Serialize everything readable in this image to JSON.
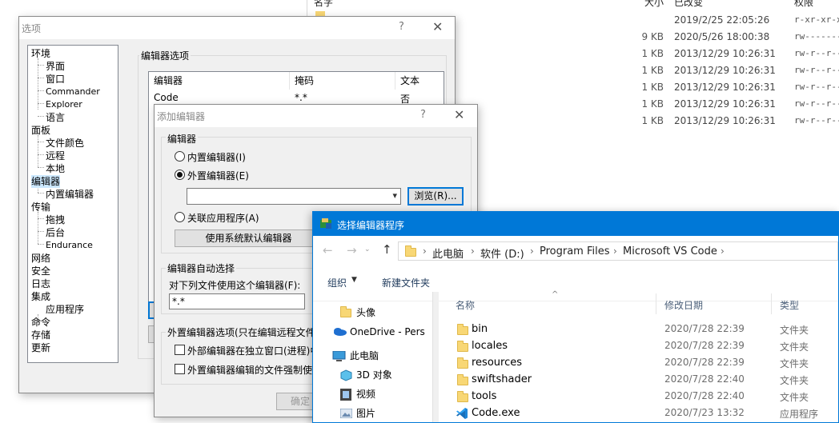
{
  "background": {
    "headers": {
      "name": "名字",
      "size": "大小",
      "modified": "已改变",
      "perms": "权限"
    },
    "rows": [
      {
        "size": "",
        "date": "2019/2/25 22:05:26",
        "perm": "r-xr-xr-x"
      },
      {
        "size": "9 KB",
        "date": "2020/5/26 18:00:38",
        "perm": "rw-------"
      },
      {
        "size": "1 KB",
        "date": "2013/12/29 10:26:31",
        "perm": "rw-r--r--"
      },
      {
        "size": "1 KB",
        "date": "2013/12/29 10:26:31",
        "perm": "rw-r--r--"
      },
      {
        "size": "1 KB",
        "date": "2013/12/29 10:26:31",
        "perm": "rw-r--r--"
      },
      {
        "size": "1 KB",
        "date": "2013/12/29 10:26:31",
        "perm": "rw-r--r--"
      },
      {
        "size": "1 KB",
        "date": "2013/12/29 10:26:31",
        "perm": "rw-r--r--"
      }
    ]
  },
  "options_dialog": {
    "title": "选项",
    "help": "?",
    "close": "✕",
    "tree": [
      "环境",
      "界面",
      "窗口",
      "Commander",
      "Explorer",
      "语言",
      "面板",
      "文件颜色",
      "远程",
      "本地",
      "编辑器",
      "内置编辑器",
      "传输",
      "拖拽",
      "后台",
      "Endurance",
      "网络",
      "安全",
      "日志",
      "集成",
      "应用程序",
      "命令",
      "存储",
      "更新"
    ],
    "section_label": "编辑器选项",
    "list_headers": [
      "编辑器",
      "掩码",
      "文本"
    ],
    "list_rows": [
      {
        "editor": "Code",
        "mask": "*.*",
        "text": "否"
      }
    ]
  },
  "add_editor_dialog": {
    "title": "添加编辑器",
    "help": "?",
    "close": "✕",
    "editor_group": "编辑器",
    "radio_internal": "内置编辑器(I)",
    "radio_external": "外置编辑器(E)",
    "external_path": "",
    "browse_label": "浏览(R)...",
    "radio_associated": "关联应用程序(A)",
    "default_editor_button": "使用系统默认编辑器",
    "autoselect_group": "编辑器自动选择",
    "autoselect_label": "对下列文件使用这个编辑器(F):",
    "autoselect_value": "*.*",
    "external_opts_group": "外置编辑器选项(只在编辑远程文件",
    "check_own_window": "外部编辑器在独立窗口(进程)中",
    "check_force_text": "外置编辑器编辑的文件强制使",
    "ok_label": "确定"
  },
  "file_picker": {
    "title": "选择编辑器程序",
    "breadcrumb": [
      "此电脑",
      "软件 (D:)",
      "Program Files",
      "Microsoft VS Code"
    ],
    "organize": "组织",
    "new_folder": "新建文件夹",
    "nav": [
      "头像",
      "OneDrive - Pers",
      "此电脑",
      "3D 对象",
      "视频",
      "图片"
    ],
    "columns": [
      "名称",
      "修改日期",
      "类型"
    ],
    "files": [
      {
        "name": "bin",
        "date": "2020/7/28 22:39",
        "type": "文件夹",
        "icon": "folder-icon"
      },
      {
        "name": "locales",
        "date": "2020/7/28 22:39",
        "type": "文件夹",
        "icon": "folder-icon"
      },
      {
        "name": "resources",
        "date": "2020/7/28 22:39",
        "type": "文件夹",
        "icon": "folder-icon"
      },
      {
        "name": "swiftshader",
        "date": "2020/7/28 22:40",
        "type": "文件夹",
        "icon": "folder-icon"
      },
      {
        "name": "tools",
        "date": "2020/7/28 22:40",
        "type": "文件夹",
        "icon": "folder-icon"
      },
      {
        "name": "Code.exe",
        "date": "2020/7/23 13:32",
        "type": "应用程序",
        "icon": "vscode-icon"
      }
    ]
  }
}
